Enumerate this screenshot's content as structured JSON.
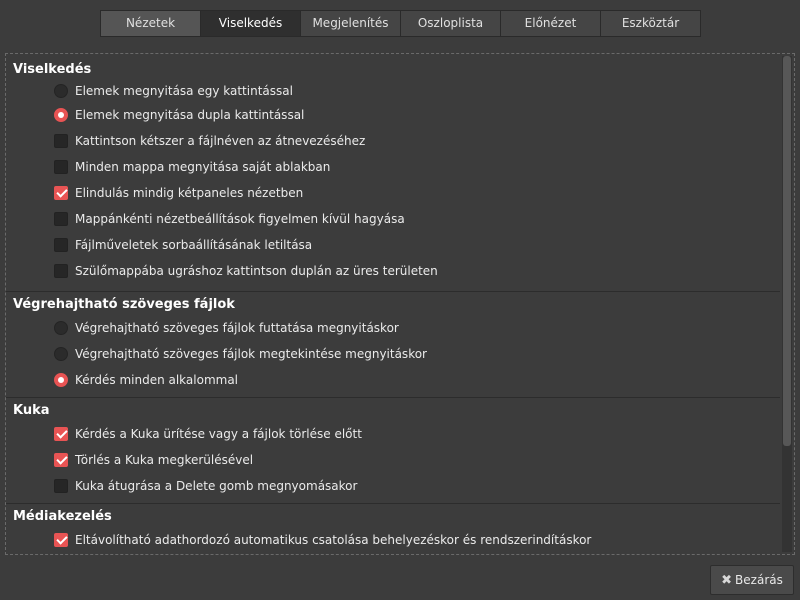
{
  "tabs": [
    {
      "label": "Nézetek"
    },
    {
      "label": "Viselkedés"
    },
    {
      "label": "Megjelenítés"
    },
    {
      "label": "Oszloplista"
    },
    {
      "label": "Előnézet"
    },
    {
      "label": "Eszköztár"
    }
  ],
  "active_tab": "Viselkedés",
  "sections": {
    "behavior": {
      "title": "Viselkedés",
      "options": [
        {
          "type": "radio",
          "label": "Elemek megnyitása egy kattintással",
          "checked": false
        },
        {
          "type": "radio",
          "label": "Elemek megnyitása dupla kattintással",
          "checked": true
        },
        {
          "type": "checkbox",
          "label": "Kattintson kétszer a fájlnéven az átnevezéséhez",
          "checked": false
        },
        {
          "type": "checkbox",
          "label": "Minden mappa megnyitása saját ablakban",
          "checked": false
        },
        {
          "type": "checkbox",
          "label": "Elindulás mindig kétpaneles nézetben",
          "checked": true
        },
        {
          "type": "checkbox",
          "label": "Mappánkénti nézetbeállítások figyelmen kívül hagyása",
          "checked": false
        },
        {
          "type": "checkbox",
          "label": "Fájlműveletek sorbaállításának letiltása",
          "checked": false
        },
        {
          "type": "checkbox",
          "label": "Szülőmappába ugráshoz kattintson duplán az üres területen",
          "checked": false
        }
      ]
    },
    "executable": {
      "title": "Végrehajtható szöveges fájlok",
      "options": [
        {
          "type": "radio",
          "label": "Végrehajtható szöveges fájlok futtatása megnyitáskor",
          "checked": false
        },
        {
          "type": "radio",
          "label": "Végrehajtható szöveges fájlok megtekintése megnyitáskor",
          "checked": false
        },
        {
          "type": "radio",
          "label": "Kérdés minden alkalommal",
          "checked": true
        }
      ]
    },
    "trash": {
      "title": "Kuka",
      "options": [
        {
          "type": "checkbox",
          "label": "Kérdés a Kuka ürítése vagy a fájlok törlése előtt",
          "checked": true
        },
        {
          "type": "checkbox",
          "label": "Törlés a Kuka megkerülésével",
          "checked": true
        },
        {
          "type": "checkbox",
          "label": "Kuka átugrása a Delete gomb megnyomásakor",
          "checked": false
        }
      ]
    },
    "media": {
      "title": "Médiakezelés",
      "options": [
        {
          "type": "checkbox",
          "label": "Eltávolítható adathordozó automatikus csatolása behelyezéskor és rendszerindításkor",
          "checked": true
        }
      ]
    }
  },
  "close_button": {
    "label": "Bezárás",
    "icon": "close-icon"
  },
  "colors": {
    "accent": "#e85454",
    "background": "#3c3c3c"
  }
}
